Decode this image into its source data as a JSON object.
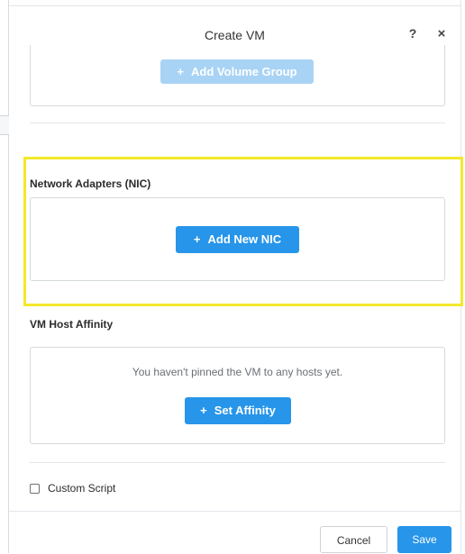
{
  "dialog": {
    "title": "Create VM",
    "help_label": "?",
    "close_label": "×"
  },
  "volume_group": {
    "add_button_plus": "+",
    "add_button_label": "Add Volume Group",
    "add_button_state": "disabled"
  },
  "network": {
    "label": "Network Adapters (NIC)",
    "add_button_plus": "+",
    "add_button_label": "Add New NIC"
  },
  "affinity": {
    "label": "VM Host Affinity",
    "empty_message": "You haven't pinned the VM to any hosts yet.",
    "set_button_plus": "+",
    "set_button_label": "Set Affinity"
  },
  "custom_script": {
    "label": "Custom Script",
    "checked": false
  },
  "footer": {
    "cancel_label": "Cancel",
    "save_label": "Save"
  },
  "colors": {
    "primary": "#2795e9",
    "primary_disabled": "#a8d3f5",
    "highlight": "#f4e82a"
  }
}
